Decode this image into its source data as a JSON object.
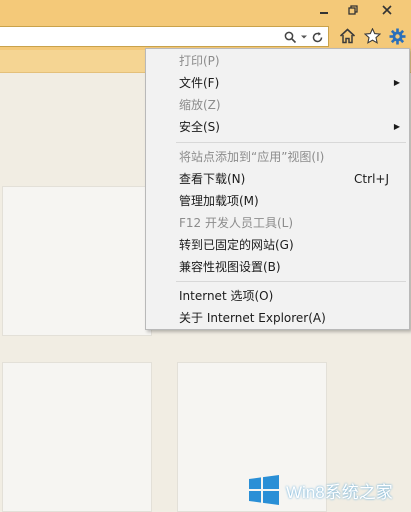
{
  "window": {
    "minimize_icon": "minimize-icon",
    "restore_icon": "restore-icon",
    "close_icon": "close-icon"
  },
  "address_bar": {
    "value": "",
    "icons": [
      "search-icon",
      "dropdown-arrow-icon",
      "refresh-icon"
    ]
  },
  "toolbar": {
    "icons": [
      "home-icon",
      "favorites-star-icon",
      "tools-gear-icon"
    ]
  },
  "menu": {
    "items": [
      {
        "label": "打印(P)",
        "enabled": false,
        "submenu": false
      },
      {
        "label": "文件(F)",
        "enabled": true,
        "submenu": true
      },
      {
        "label": "缩放(Z)",
        "enabled": false,
        "submenu": false
      },
      {
        "label": "安全(S)",
        "enabled": true,
        "submenu": true
      },
      {
        "label": "将站点添加到“应用”视图(I)",
        "enabled": false,
        "submenu": false
      },
      {
        "label": "查看下载(N)",
        "enabled": true,
        "submenu": false,
        "shortcut": "Ctrl+J"
      },
      {
        "label": "管理加载项(M)",
        "enabled": true,
        "submenu": false
      },
      {
        "label": "F12 开发人员工具(L)",
        "enabled": false,
        "submenu": false
      },
      {
        "label": "转到已固定的网站(G)",
        "enabled": true,
        "submenu": false
      },
      {
        "label": "兼容性视图设置(B)",
        "enabled": true,
        "submenu": false
      },
      {
        "label": "Internet 选项(O)",
        "enabled": true,
        "submenu": false
      },
      {
        "label": "关于 Internet Explorer(A)",
        "enabled": true,
        "submenu": false
      }
    ]
  },
  "watermark": {
    "text": "Win8系统之家",
    "logo_icon": "windows-logo-icon"
  },
  "colors": {
    "chrome": "#f4c979",
    "band": "#f5d593",
    "background": "#f1ede3",
    "menu_bg": "#f2f2f2",
    "disabled_text": "#8c8c8c",
    "accent_blue": "#2a8fd6"
  }
}
